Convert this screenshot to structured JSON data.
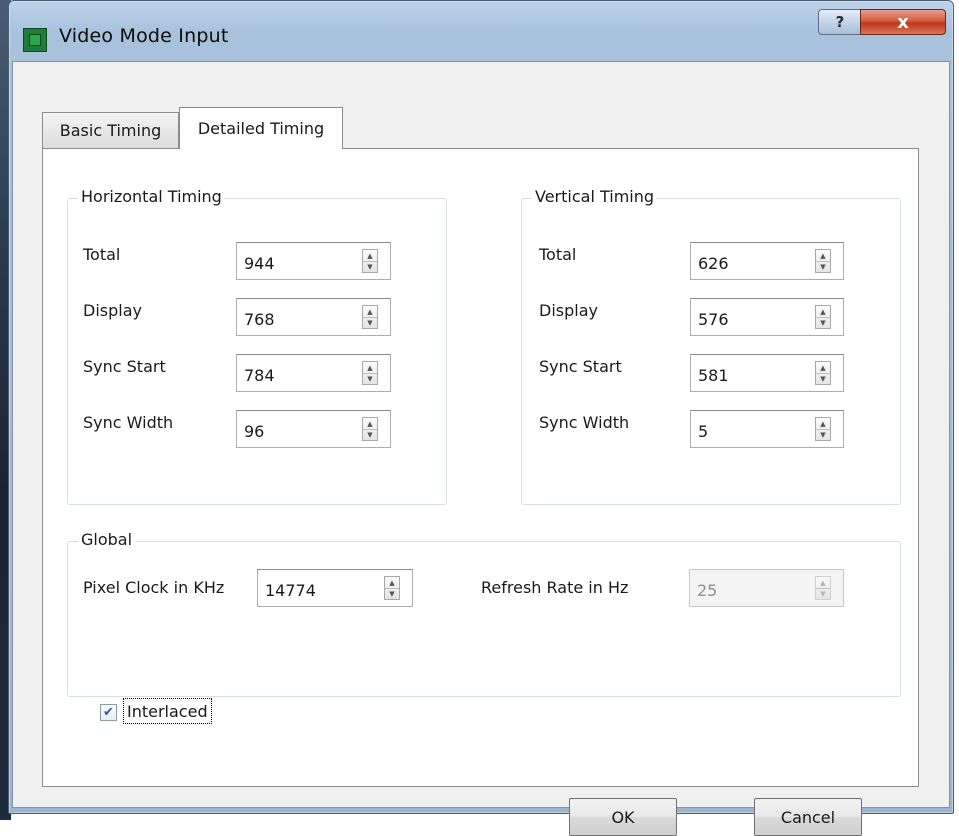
{
  "window": {
    "title": "Video Mode Input",
    "help_label": "?",
    "close_label": "x"
  },
  "tabs": [
    {
      "label": "Basic Timing",
      "active": false
    },
    {
      "label": "Detailed Timing",
      "active": true
    }
  ],
  "horizontal": {
    "title": "Horizontal Timing",
    "rows": [
      {
        "label": "Total",
        "value": "944"
      },
      {
        "label": "Display",
        "value": "768"
      },
      {
        "label": "Sync Start",
        "value": "784"
      },
      {
        "label": "Sync Width",
        "value": "96"
      }
    ]
  },
  "vertical": {
    "title": "Vertical Timing",
    "rows": [
      {
        "label": "Total",
        "value": "626"
      },
      {
        "label": "Display",
        "value": "576"
      },
      {
        "label": "Sync Start",
        "value": "581"
      },
      {
        "label": "Sync Width",
        "value": "5"
      }
    ]
  },
  "global": {
    "title": "Global",
    "pixel_clock_label": "Pixel Clock in KHz",
    "pixel_clock_value": "14774",
    "refresh_rate_label": "Refresh Rate in Hz",
    "refresh_rate_value": "25",
    "refresh_rate_disabled": true,
    "interlaced_label": "Interlaced",
    "interlaced_checked": true
  },
  "buttons": {
    "ok": "OK",
    "cancel": "Cancel"
  }
}
